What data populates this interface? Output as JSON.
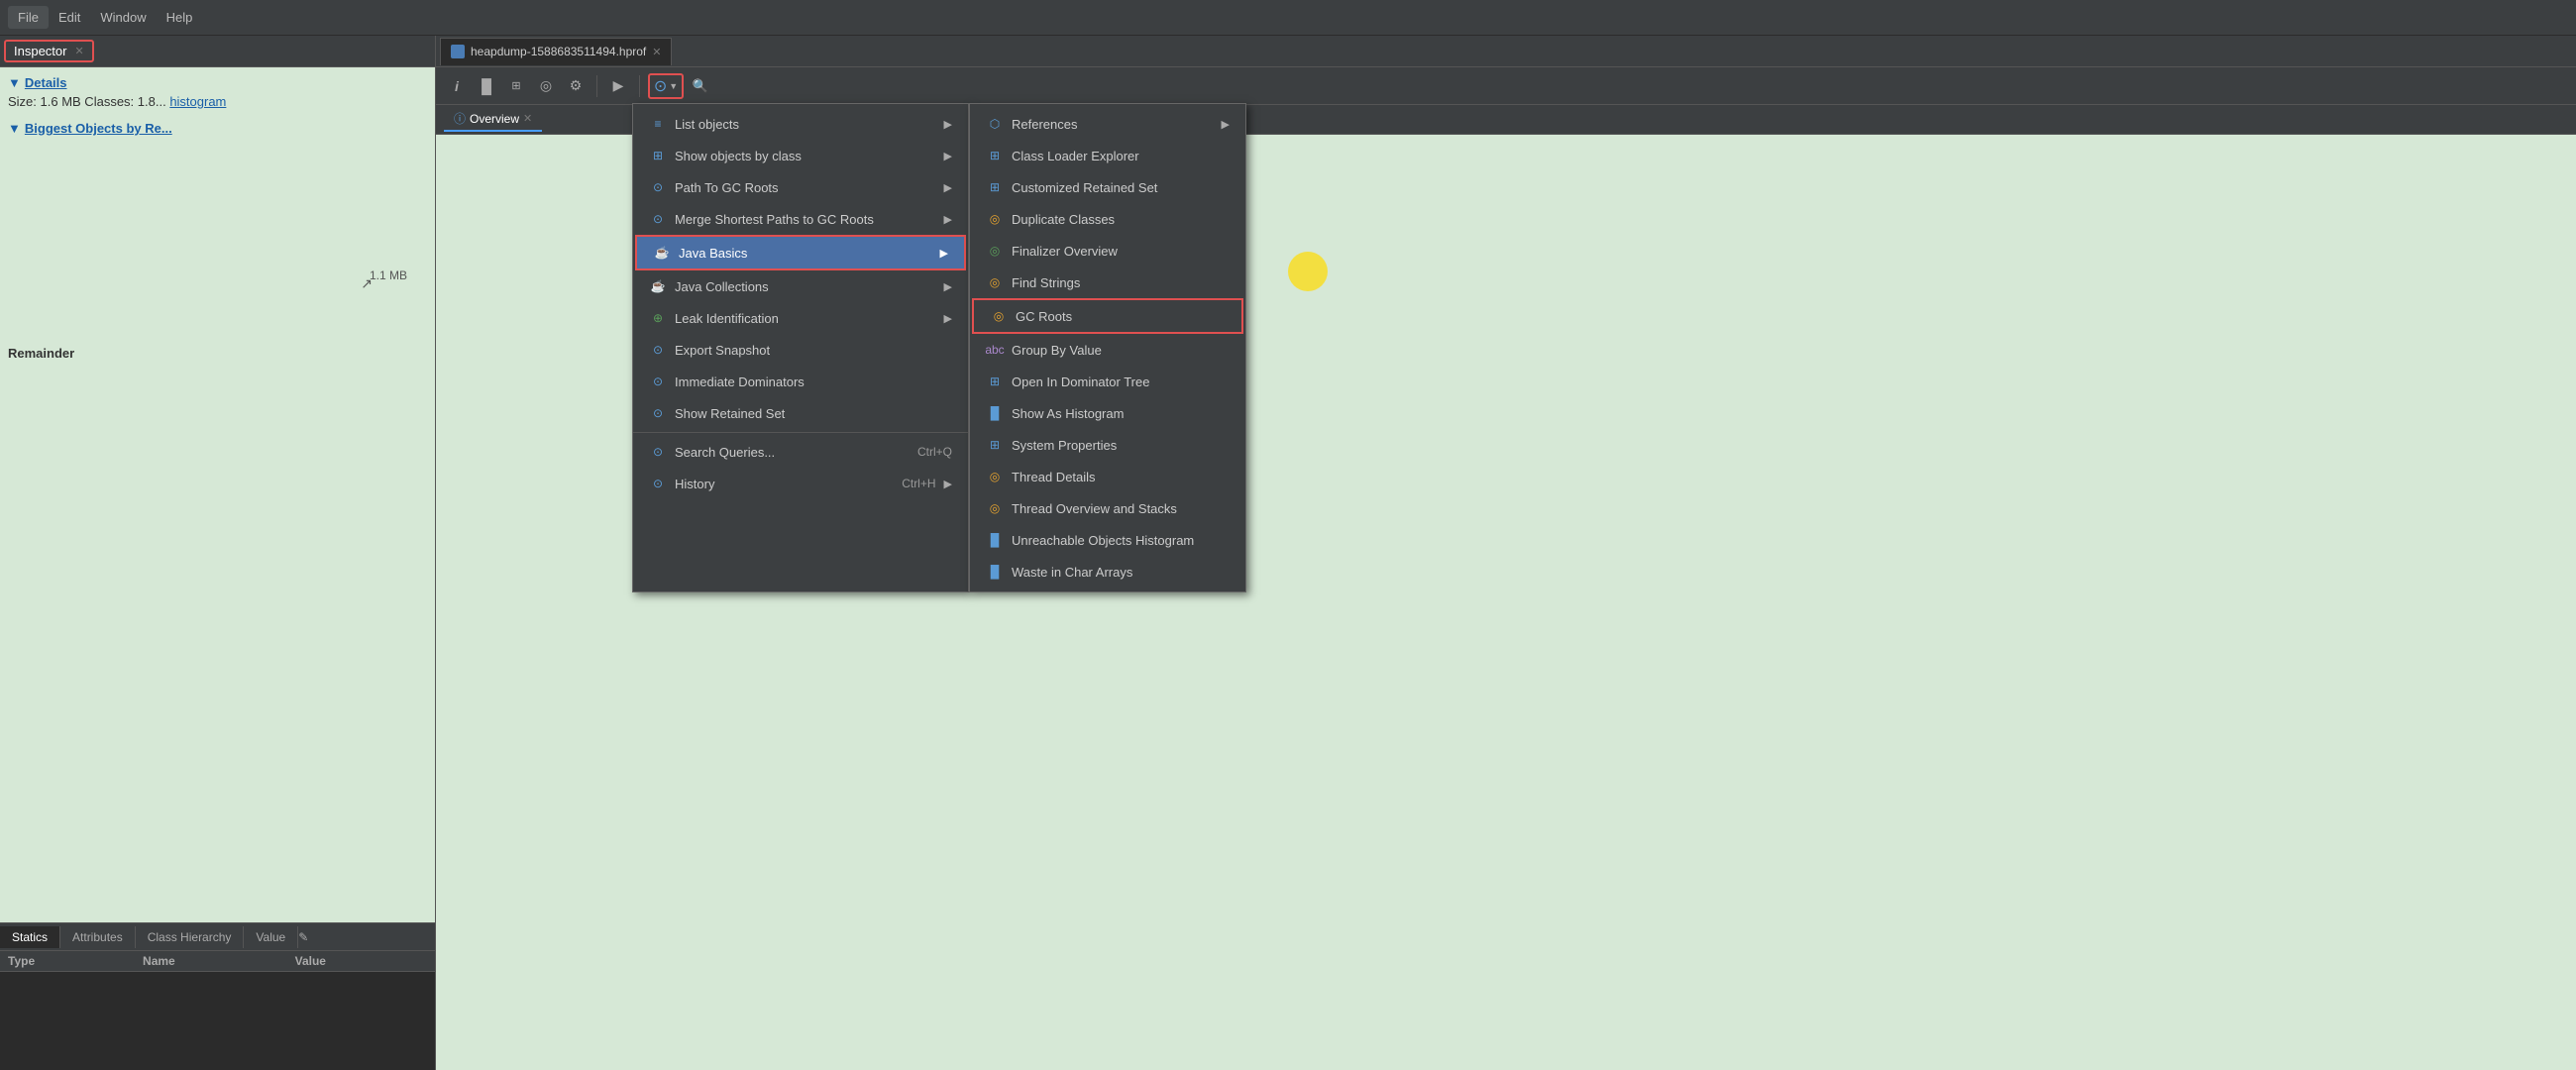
{
  "menubar": {
    "items": [
      "File",
      "Edit",
      "Window",
      "Help"
    ]
  },
  "left_panel": {
    "tab_label": "Inspector",
    "tab_close": "✕",
    "details": {
      "header": "Details",
      "size_line": "Size: 1.6 MB  Classes: 1.8...",
      "histogram_link": "histogram"
    },
    "biggest_objects": {
      "header": "Biggest Objects by Re..."
    },
    "bottom_tabs": [
      "Statics",
      "Attributes",
      "Class Hierarchy",
      "Value"
    ],
    "table_headers": [
      "Type",
      "Name",
      "Value"
    ]
  },
  "right_panel": {
    "file_tab": {
      "label": "heapdump-1588683511494.hprof",
      "close": "✕"
    },
    "toolbar_buttons": [
      {
        "name": "info-btn",
        "icon": "i",
        "label": "Info"
      },
      {
        "name": "chart-btn",
        "icon": "▐▌",
        "label": "Chart"
      },
      {
        "name": "list-btn",
        "icon": "⊞",
        "label": "List"
      },
      {
        "name": "objects-btn",
        "icon": "◉",
        "label": "Objects"
      },
      {
        "name": "settings-btn",
        "icon": "⚙",
        "label": "Settings"
      },
      {
        "name": "play-btn",
        "icon": "▶",
        "label": "Play"
      },
      {
        "name": "query-btn",
        "icon": "⊙",
        "label": "Query",
        "active": true
      },
      {
        "name": "search-btn",
        "icon": "🔍",
        "label": "Search"
      }
    ],
    "overview_tab": {
      "label": "Overview",
      "close": "✕"
    }
  },
  "primary_menu": {
    "items": [
      {
        "id": "list-objects",
        "label": "List objects",
        "has_submenu": true,
        "icon": "list"
      },
      {
        "id": "show-objects-by-class",
        "label": "Show objects by class",
        "has_submenu": true,
        "icon": "class"
      },
      {
        "id": "path-to-gc-roots",
        "label": "Path To GC Roots",
        "has_submenu": true,
        "icon": "path"
      },
      {
        "id": "merge-shortest-paths",
        "label": "Merge Shortest Paths to GC Roots",
        "has_submenu": true,
        "icon": "merge"
      },
      {
        "id": "java-basics",
        "label": "Java Basics",
        "has_submenu": true,
        "icon": "java",
        "highlighted": true
      },
      {
        "id": "java-collections",
        "label": "Java Collections",
        "has_submenu": true,
        "icon": "collection"
      },
      {
        "id": "leak-identification",
        "label": "Leak Identification",
        "has_submenu": true,
        "icon": "leak"
      },
      {
        "id": "export-snapshot",
        "label": "Export Snapshot",
        "has_submenu": false,
        "icon": "export"
      },
      {
        "id": "immediate-dominators",
        "label": "Immediate Dominators",
        "has_submenu": false,
        "icon": "dom"
      },
      {
        "id": "show-retained-set",
        "label": "Show Retained Set",
        "has_submenu": false,
        "icon": "set"
      },
      {
        "id": "search-queries",
        "label": "Search Queries...",
        "shortcut": "Ctrl+Q",
        "has_submenu": false,
        "icon": "search"
      },
      {
        "id": "history",
        "label": "History",
        "shortcut": "Ctrl+H",
        "has_submenu": true,
        "icon": "history"
      }
    ]
  },
  "submenu": {
    "items": [
      {
        "id": "references",
        "label": "References",
        "has_submenu": true,
        "icon": "ref"
      },
      {
        "id": "class-loader-explorer",
        "label": "Class Loader Explorer",
        "has_submenu": false,
        "icon": "loader"
      },
      {
        "id": "customized-retained-set",
        "label": "Customized Retained Set",
        "has_submenu": false,
        "icon": "retained"
      },
      {
        "id": "duplicate-classes",
        "label": "Duplicate Classes",
        "has_submenu": false,
        "icon": "dup"
      },
      {
        "id": "finalizer-overview",
        "label": "Finalizer Overview",
        "has_submenu": false,
        "icon": "finalizer"
      },
      {
        "id": "find-strings",
        "label": "Find Strings",
        "has_submenu": false,
        "icon": "strings"
      },
      {
        "id": "gc-roots",
        "label": "GC Roots",
        "has_submenu": false,
        "icon": "gc",
        "highlighted": true
      },
      {
        "id": "group-by-value",
        "label": "Group By Value",
        "has_submenu": false,
        "icon": "group"
      },
      {
        "id": "open-in-dominator-tree",
        "label": "Open In Dominator Tree",
        "has_submenu": false,
        "icon": "tree"
      },
      {
        "id": "show-as-histogram",
        "label": "Show As Histogram",
        "has_submenu": false,
        "icon": "histogram"
      },
      {
        "id": "system-properties",
        "label": "System Properties",
        "has_submenu": false,
        "icon": "sys"
      },
      {
        "id": "thread-details",
        "label": "Thread Details",
        "has_submenu": false,
        "icon": "thread"
      },
      {
        "id": "thread-overview-stacks",
        "label": "Thread Overview and Stacks",
        "has_submenu": false,
        "icon": "stacks"
      },
      {
        "id": "unreachable-objects",
        "label": "Unreachable Objects Histogram",
        "has_submenu": false,
        "icon": "unreachable"
      },
      {
        "id": "waste-in-char-arrays",
        "label": "Waste in Char Arrays",
        "has_submenu": false,
        "icon": "waste"
      }
    ]
  }
}
